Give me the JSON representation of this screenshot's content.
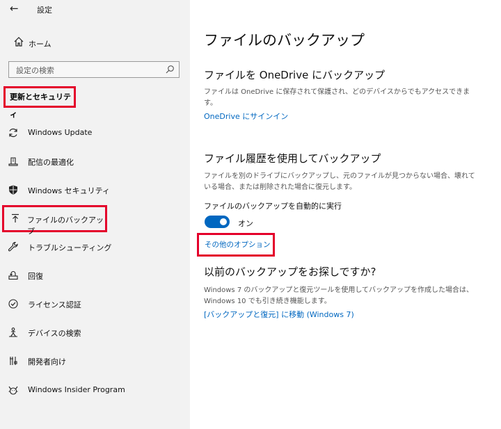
{
  "colors": {
    "accent": "#0067c0",
    "highlight_border": "#e4002b",
    "sidebar_bg": "#f2f2f2"
  },
  "sidebar": {
    "back_icon": "arrow-left-icon",
    "app_title": "設定",
    "home": {
      "label": "ホーム",
      "icon": "home-icon"
    },
    "search": {
      "placeholder": "設定の検索",
      "icon": "search-icon"
    },
    "section_heading": "更新とセキュリティ",
    "items": [
      {
        "label": "Windows Update",
        "icon": "sync-icon"
      },
      {
        "label": "配信の最適化",
        "icon": "delivery-optimization-icon"
      },
      {
        "label": "Windows セキュリティ",
        "icon": "shield-icon"
      },
      {
        "label": "ファイルのバックアップ",
        "icon": "backup-upload-icon",
        "selected": true
      },
      {
        "label": "トラブルシューティング",
        "icon": "wrench-icon"
      },
      {
        "label": "回復",
        "icon": "recovery-icon"
      },
      {
        "label": "ライセンス認証",
        "icon": "check-circle-icon"
      },
      {
        "label": "デバイスの検索",
        "icon": "find-device-icon"
      },
      {
        "label": "開発者向け",
        "icon": "developer-icon"
      },
      {
        "label": "Windows Insider Program",
        "icon": "insider-icon"
      }
    ]
  },
  "main": {
    "title": "ファイルのバックアップ",
    "onedrive": {
      "heading": "ファイルを OneDrive にバックアップ",
      "description": "ファイルは OneDrive に保存されて保護され、どのデバイスからでもアクセスできます。",
      "link": "OneDrive にサインイン"
    },
    "file_history": {
      "heading": "ファイル履歴を使用してバックアップ",
      "description": "ファイルを別のドライブにバックアップし、元のファイルが見つからない場合、壊れている場合、または削除された場合に復元します。",
      "auto_backup_label": "ファイルのバックアップを自動的に実行",
      "toggle_state": "オン",
      "more_options": "その他のオプション"
    },
    "older_backup": {
      "heading": "以前のバックアップをお探しですか?",
      "description": "Windows 7 のバックアップと復元ツールを使用してバックアップを作成した場合は、Windows 10 でも引き続き機能します。",
      "link": "[バックアップと復元] に移動 (Windows 7)"
    }
  }
}
